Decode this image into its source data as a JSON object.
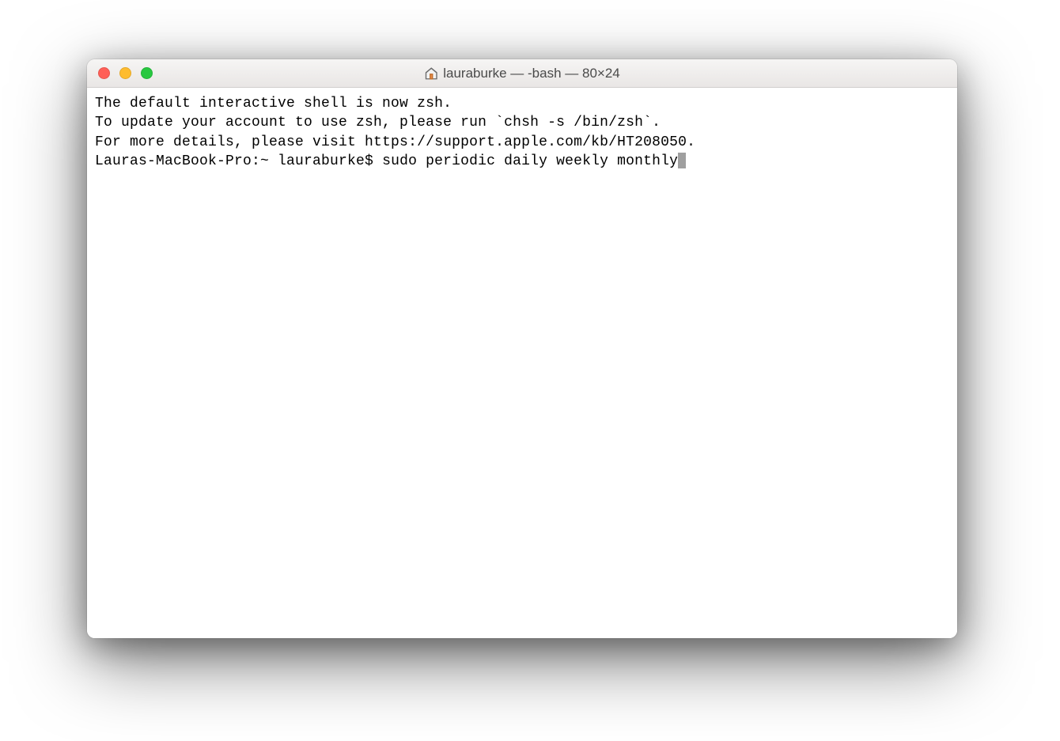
{
  "window": {
    "title": "lauraburke — -bash — 80×24"
  },
  "terminal": {
    "lines": [
      "The default interactive shell is now zsh.",
      "To update your account to use zsh, please run `chsh -s /bin/zsh`.",
      "For more details, please visit https://support.apple.com/kb/HT208050."
    ],
    "prompt": "Lauras-MacBook-Pro:~ lauraburke$ ",
    "command": "sudo periodic daily weekly monthly"
  },
  "traffic_lights": {
    "close": "close",
    "minimize": "minimize",
    "maximize": "maximize"
  }
}
